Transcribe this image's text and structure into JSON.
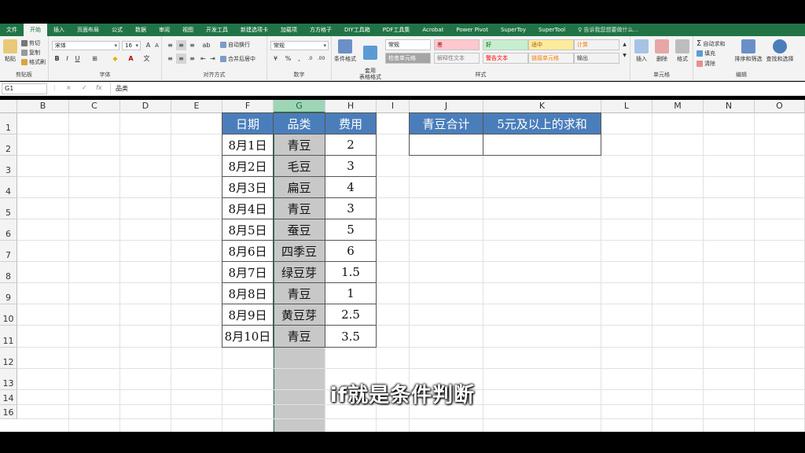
{
  "ribbon_tabs": [
    "文件",
    "开始",
    "插入",
    "页面布局",
    "公式",
    "数据",
    "审阅",
    "视图",
    "开发工具",
    "新建选项卡",
    "加载项",
    "方方格子",
    "DIY工具箱",
    "PDF工具集",
    "Acrobat",
    "Power Pivot",
    "SuperToy",
    "SuperTool"
  ],
  "active_tab": "开始",
  "tell_me": "告诉我您想要做什么...",
  "clipboard": {
    "paste": "粘贴",
    "cut": "剪切",
    "copy": "复制",
    "format_painter": "格式刷",
    "label": "剪贴板"
  },
  "font": {
    "name": "宋体",
    "size": "16",
    "bold": "B",
    "italic": "I",
    "underline": "U",
    "label": "字体"
  },
  "alignment": {
    "wrap": "自动换行",
    "merge": "合并后居中",
    "label": "对齐方式"
  },
  "number": {
    "format": "常规",
    "label": "数字"
  },
  "styles": {
    "cond_format": "条件格式",
    "table_format": "套用\n表格格式",
    "cells": [
      {
        "text": "常规",
        "bg": "#ffffff",
        "fg": "#222222"
      },
      {
        "text": "差",
        "bg": "#ffc7ce",
        "fg": "#9c0006"
      },
      {
        "text": "好",
        "bg": "#c6efce",
        "fg": "#006100"
      },
      {
        "text": "适中",
        "bg": "#ffeb9c",
        "fg": "#9c5700"
      },
      {
        "text": "计算",
        "bg": "#f2f2f2",
        "fg": "#fa7d00"
      },
      {
        "text": "检查单元格",
        "bg": "#a5a5a5",
        "fg": "#ffffff"
      },
      {
        "text": "解释性文本",
        "bg": "#f3f3f3",
        "fg": "#7f7f7f"
      },
      {
        "text": "警告文本",
        "bg": "#f3f3f3",
        "fg": "#ff0000"
      },
      {
        "text": "链接单元格",
        "bg": "#f3f3f3",
        "fg": "#fa7d00"
      },
      {
        "text": "输出",
        "bg": "#f2f2f2",
        "fg": "#3f3f3f"
      }
    ],
    "label": "样式"
  },
  "cells_group": {
    "insert": "插入",
    "delete": "删除",
    "format": "格式",
    "label": "单元格"
  },
  "editing": {
    "autosum": "自动求和",
    "fill": "填充",
    "clear": "清除",
    "sort": "排序和筛选",
    "find": "查找和选择",
    "label": "编辑"
  },
  "formula_bar": {
    "name_box": "G1",
    "x": "×",
    "check": "✓",
    "fx": "fx",
    "content": "品类"
  },
  "columns": [
    "B",
    "C",
    "D",
    "E",
    "F",
    "G",
    "H",
    "I",
    "J",
    "K",
    "L",
    "M",
    "N",
    "O"
  ],
  "selected_column": "G",
  "rows": [
    "1",
    "2",
    "3",
    "4",
    "5",
    "6",
    "7",
    "8",
    "9",
    "10",
    "11",
    "12",
    "13",
    "14",
    "16"
  ],
  "table": {
    "headers": [
      "日期",
      "品类",
      "费用"
    ],
    "data": [
      [
        "8月1日",
        "青豆",
        "2"
      ],
      [
        "8月2日",
        "毛豆",
        "3"
      ],
      [
        "8月3日",
        "扁豆",
        "4"
      ],
      [
        "8月4日",
        "青豆",
        "3"
      ],
      [
        "8月5日",
        "蚕豆",
        "5"
      ],
      [
        "8月6日",
        "四季豆",
        "6"
      ],
      [
        "8月7日",
        "绿豆芽",
        "1.5"
      ],
      [
        "8月8日",
        "青豆",
        "1"
      ],
      [
        "8月9日",
        "黄豆芽",
        "2.5"
      ],
      [
        "8月10日",
        "青豆",
        "3.5"
      ]
    ]
  },
  "summary": {
    "headers": [
      "青豆合计",
      "5元及以上的求和"
    ],
    "values": [
      "",
      ""
    ]
  },
  "subtitle": "if就是条件判断"
}
